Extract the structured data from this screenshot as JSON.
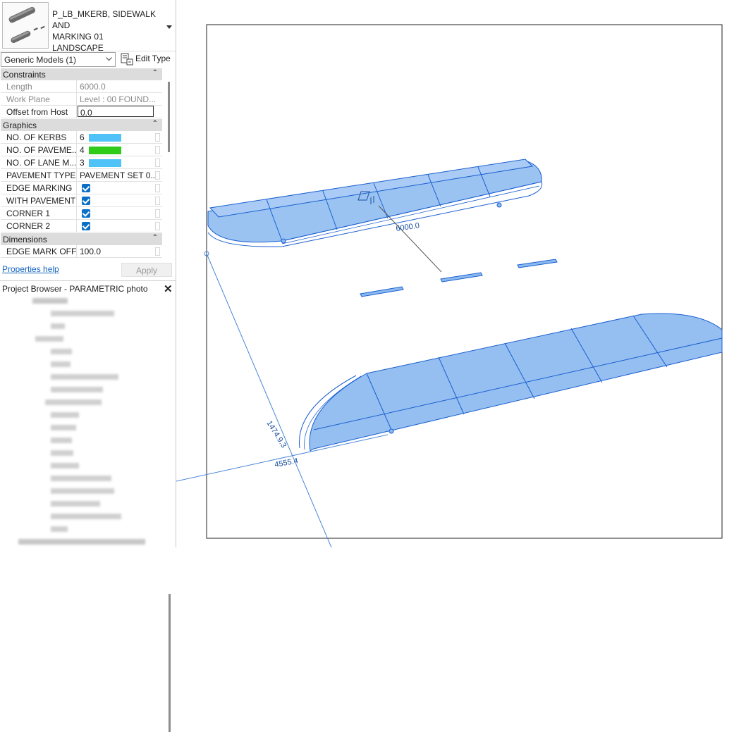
{
  "type_selector": {
    "name": "P_LB_MKERB, SIDEWALK AND\nMARKING 01\nLANDSCAPE",
    "instance_filter": "Generic Models (1)",
    "edit_type": "Edit Type"
  },
  "groups": {
    "constraints": "Constraints",
    "graphics": "Graphics",
    "dimensions": "Dimensions"
  },
  "constraints": [
    {
      "key": "Length",
      "value": "6000.0"
    },
    {
      "key": "Work Plane",
      "value": "Level : 00 FOUND..."
    },
    {
      "key": "Offset from Host",
      "value": "0.0"
    }
  ],
  "graphics": [
    {
      "key": "NO. OF KERBS",
      "value": "6",
      "swatch": "#4fc3f7"
    },
    {
      "key": "NO. OF PAVEME...",
      "value": "4",
      "swatch": "#2ecc18"
    },
    {
      "key": "NO. OF LANE M...",
      "value": "3",
      "swatch": "#4fc3f7"
    },
    {
      "key": "PAVEMENT TYPE...",
      "value": "PAVEMENT SET 0..."
    },
    {
      "key": "EDGE MARKING",
      "checked": true
    },
    {
      "key": "WITH PAVEMENT",
      "checked": true
    },
    {
      "key": "CORNER 1",
      "checked": true
    },
    {
      "key": "CORNER 2",
      "checked": true
    }
  ],
  "dimensions": [
    {
      "key": "EDGE MARK OFF...",
      "value": "100.0"
    }
  ],
  "footer": {
    "help": "Properties help",
    "apply": "Apply"
  },
  "project_browser": {
    "title": "Project Browser - PARAMETRIC photo",
    "close": "✕"
  },
  "viewport": {
    "length_label": "6000.0",
    "dim_a": "1474.9.3",
    "dim_b": "4555.4",
    "model_color": "#8ab8f0",
    "edge_color": "#1a5fd0"
  }
}
